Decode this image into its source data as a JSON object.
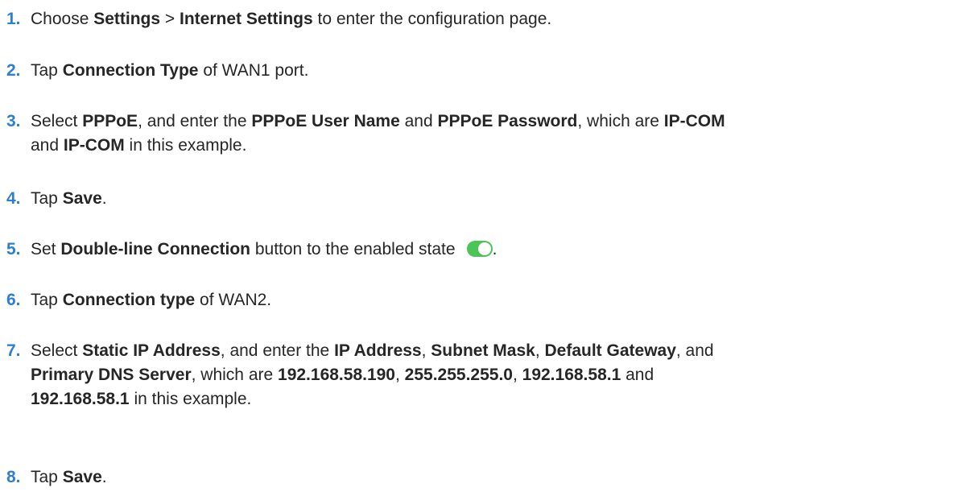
{
  "colors": {
    "step_number": "#2f7fd1",
    "toggle_on": "#4cc557",
    "text": "#262626"
  },
  "steps": [
    {
      "num": "1.",
      "parts": [
        "Choose ",
        "Settings",
        " > ",
        "Internet Settings",
        " to enter the configuration page."
      ]
    },
    {
      "num": "2.",
      "parts": [
        "Tap ",
        "Connection Type",
        " of WAN1 port."
      ]
    },
    {
      "num": "3.",
      "line1": [
        "Select ",
        "PPPoE",
        ", and enter the ",
        "PPPoE User Name",
        " and ",
        "PPPoE Password",
        ", which are ",
        "IP-COM"
      ],
      "line2": [
        "and ",
        "IP-COM",
        " in this example."
      ]
    },
    {
      "num": "4.",
      "parts": [
        "Tap ",
        "Save",
        "."
      ]
    },
    {
      "num": "5.",
      "parts": [
        "Set ",
        "Double-line Connection",
        " button to the enabled state"
      ],
      "trailing": ".",
      "toggle_icon": "toggle-switch-on-icon"
    },
    {
      "num": "6.",
      "parts": [
        "Tap ",
        "Connection type",
        " of WAN2."
      ]
    },
    {
      "num": "7.",
      "line1": [
        "Select ",
        "Static IP Address",
        ", and enter the ",
        "IP Address",
        ", ",
        "Subnet Mask",
        ", ",
        "Default Gateway",
        ", and"
      ],
      "line2": [
        "Primary DNS Server",
        ", which are ",
        "192.168.58.190",
        ", ",
        "255.255.255.0",
        ", ",
        "192.168.58.1",
        " and"
      ],
      "line3": [
        "192.168.58.1",
        " in this example."
      ]
    },
    {
      "num": "8.",
      "parts": [
        "Tap ",
        "Save",
        "."
      ]
    }
  ]
}
